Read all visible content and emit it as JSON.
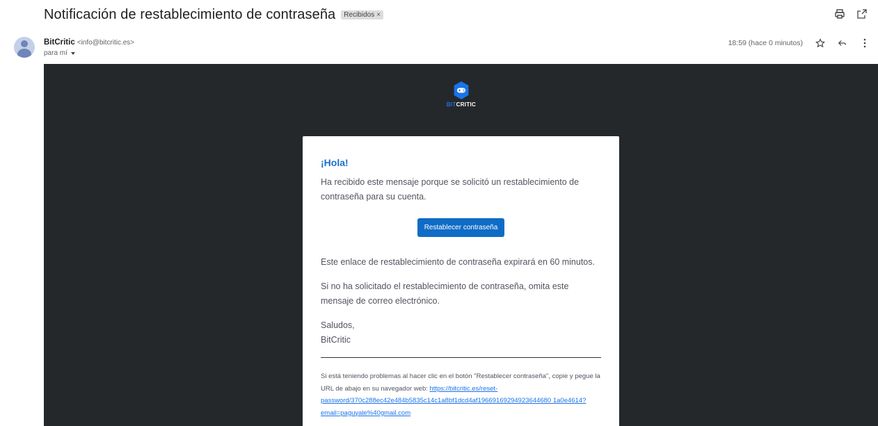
{
  "subject": "Notificación de restablecimiento de contraseña",
  "label": {
    "text": "Recibidos",
    "close": "×"
  },
  "top_icons": [
    "print-icon",
    "open-in-new-window-icon"
  ],
  "sender": {
    "name": "BitCritic",
    "email": "<info@bitcritic.es>"
  },
  "recipient": "para mí",
  "time": "18:59 (hace 0 minutos)",
  "meta_icons": [
    "star-icon",
    "reply-icon",
    "more-vert-icon"
  ],
  "brand": {
    "bit": "BIT",
    "critic": "CRITIC",
    "accent_color": "#1a73e8",
    "bg_color": "#25282b"
  },
  "email": {
    "greeting": "¡Hola!",
    "intro": "Ha recibido este mensaje porque se solicitó un restablecimiento de contraseña para su cuenta.",
    "button": "Restablecer contraseña",
    "expiry": "Este enlace de restablecimiento de contraseña expirará en 60 minutos.",
    "ignore": "Si no ha solicitado el restablecimiento de contraseña, omita este mensaje de correo electrónico.",
    "regards": "Saludos,",
    "signature": "BitCritic",
    "trouble": "Si está teniendo problemas al hacer clic en el botón \"Restablecer contraseña\", copie y pegue la URL de abajo en su navegador web:",
    "url": "https://bitcritic.es/reset-password/370c288ec42e484b5835c14c1a8bf1dcd4af19669169294923644680 1a0e4614?email=paguyale%40gmail.com"
  }
}
